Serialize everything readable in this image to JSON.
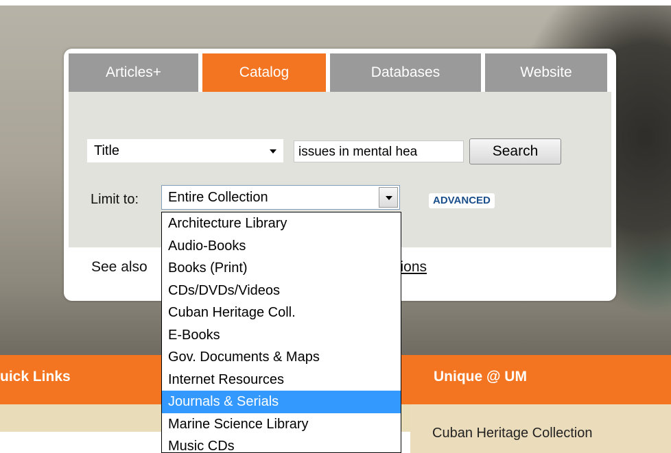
{
  "tabs": [
    {
      "label": "Articles+",
      "active": false
    },
    {
      "label": "Catalog",
      "active": true
    },
    {
      "label": "Databases",
      "active": false
    },
    {
      "label": "Website",
      "active": false
    }
  ],
  "search": {
    "field_type": "Title",
    "query": "issues in mental hea",
    "button_label": "Search",
    "limit_label": "Limit to:",
    "limit_value": "Entire Collection",
    "advanced_label": "ADVANCED"
  },
  "see_also": {
    "prefix": "See also",
    "link": "itions"
  },
  "limit_options": [
    "Architecture Library",
    "Audio-Books",
    "Books (Print)",
    "CDs/DVDs/Videos",
    "Cuban Heritage Coll.",
    "E-Books",
    "Gov. Documents & Maps",
    "Internet Resources",
    "Journals & Serials",
    "Marine Science Library",
    "Music CDs"
  ],
  "highlighted_option": "Journals & Serials",
  "footer": {
    "quick_links": "uick Links",
    "unique": "Unique @ UM",
    "cuban": "Cuban Heritage Collection"
  },
  "colors": {
    "accent": "#f47521",
    "tab_inactive": "#9a9a9a",
    "highlight": "#3399ff",
    "advanced_text": "#1a4f8b"
  }
}
